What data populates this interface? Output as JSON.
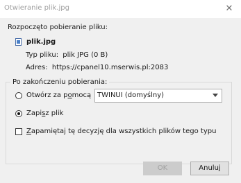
{
  "window": {
    "title": "Otwieranie plik.jpg",
    "close_glyph": "✕"
  },
  "download": {
    "intro": "Rozpoczęto pobieranie pliku:",
    "file_icon": "document-icon",
    "file_name": "plik.jpg",
    "type_label": "Typ pliku:",
    "type_value": "plik JPG (0 B)",
    "address_label": "Adres:",
    "address_value": "https://cpanel10.mserwis.pl:2083"
  },
  "options": {
    "legend": "Po zakończeniu pobierania:",
    "open_with": {
      "label_before": "Otwórz za p",
      "label_accel": "o",
      "label_after": "mocą",
      "selected": false
    },
    "app_select": {
      "value": "TWINUI (domyślny)"
    },
    "save_file": {
      "label_before": "Zapi",
      "label_accel": "s",
      "label_after": "z plik",
      "selected": true
    },
    "remember": {
      "label_accel": "Z",
      "label_after": "apamiętaj tę decyzję dla wszystkich plików tego typu",
      "checked": false
    }
  },
  "buttons": {
    "ok": "OK",
    "cancel": "Anuluj"
  }
}
